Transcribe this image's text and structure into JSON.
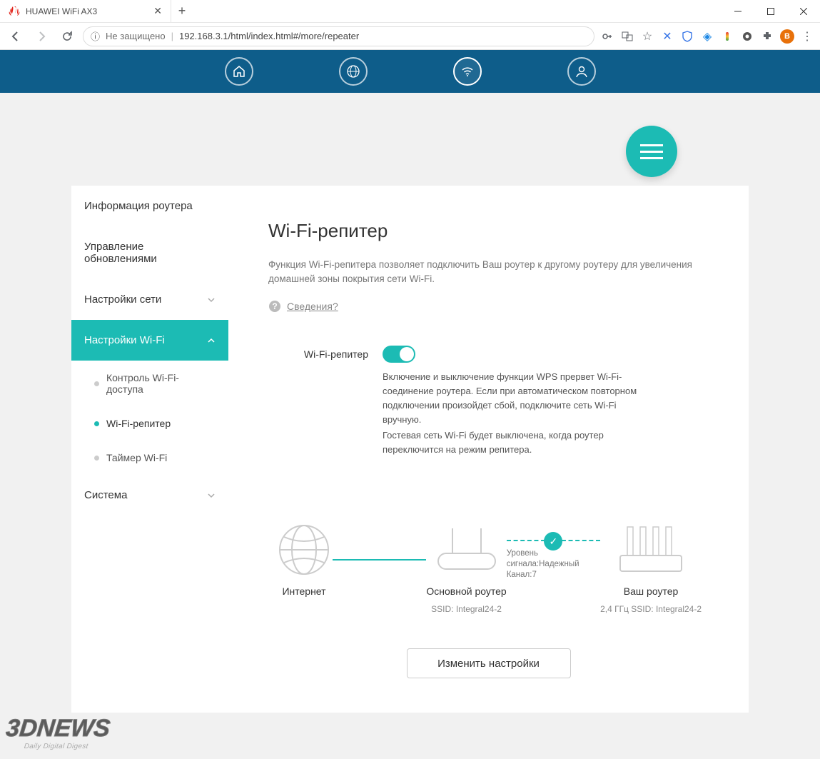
{
  "window": {
    "tab_title": "HUAWEI WiFi AX3",
    "new_tab": "+",
    "minimize": "—",
    "maximize": "□",
    "close": "✕"
  },
  "toolbar": {
    "insecure_label": "Не защищено",
    "url": "192.168.3.1/html/index.html#/more/repeater",
    "avatar_letter": "В"
  },
  "sidebar": {
    "items": [
      {
        "label": "Информация роутера"
      },
      {
        "label": "Управление обновлениями"
      },
      {
        "label": "Настройки сети"
      },
      {
        "label": "Настройки Wi-Fi"
      },
      {
        "label": "Система"
      }
    ],
    "subitems": [
      {
        "label": "Контроль Wi-Fi-доступа"
      },
      {
        "label": "Wi-Fi-репитер"
      },
      {
        "label": "Таймер Wi-Fi"
      }
    ]
  },
  "main": {
    "title": "Wi-Fi-репитер",
    "description": "Функция Wi-Fi-репитера позволяет подключить Ваш роутер к другому роутеру для увеличения домашней зоны покрытия сети Wi-Fi.",
    "details": "Сведения?",
    "repeater_label": "Wi-Fi-репитер",
    "note1": "Включение и выключение функции WPS прервет Wi-Fi-соединение роутера. Если при автоматическом повторном подключении произойдет сбой, подключите сеть Wi-Fi вручную.",
    "note2": "Гостевая сеть Wi-Fi будет выключена, когда роутер переключится на режим репитера.",
    "diagram": {
      "internet": "Интернет",
      "main_router": "Основной роутер",
      "main_router_ssid": "SSID: Integral24-2",
      "signal_label": "Уровень сигнала:Надежный",
      "channel_label": "Канал:7",
      "your_router": "Ваш роутер",
      "your_router_ssid": "2,4 ГГц SSID: Integral24-2"
    },
    "save_button": "Изменить настройки"
  },
  "watermark": {
    "l1": "3DNEWS",
    "l2": "Daily Digital Digest"
  }
}
